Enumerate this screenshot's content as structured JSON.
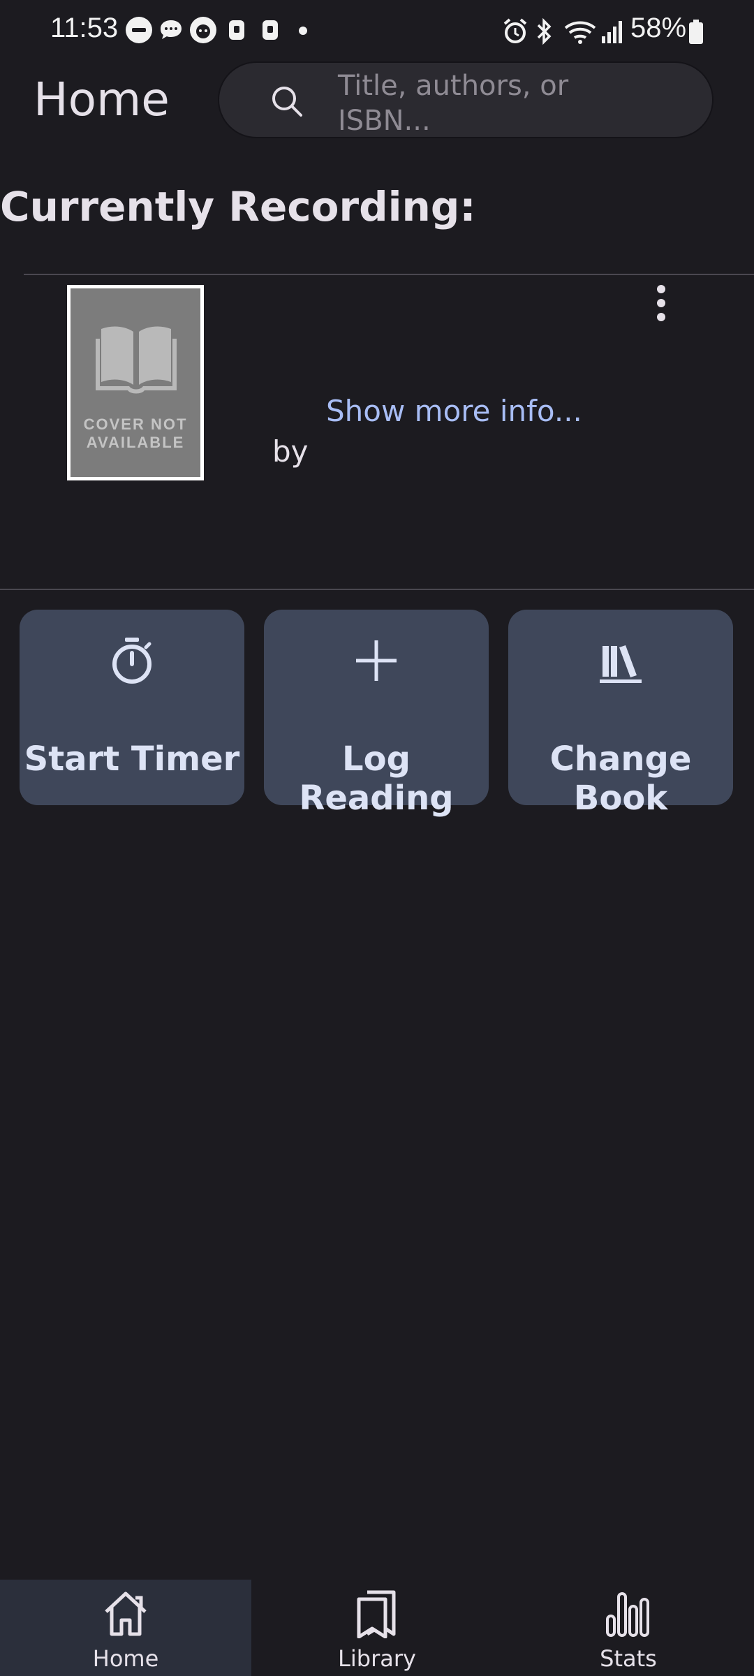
{
  "status_bar": {
    "time": "11:53",
    "battery": "58%"
  },
  "header": {
    "title": "Home",
    "search": {
      "placeholder": "Title, authors, or ISBN..."
    }
  },
  "section": {
    "title": "Currently Recording:"
  },
  "book": {
    "cover_label_line1": "COVER NOT",
    "cover_label_line2": "AVAILABLE",
    "show_more": "Show more info...",
    "by": "by"
  },
  "actions": [
    {
      "label": "Start Timer",
      "icon": "timer-icon"
    },
    {
      "label": "Log Reading",
      "icon": "plus-icon"
    },
    {
      "label": "Change Book",
      "icon": "books-icon"
    }
  ],
  "nav": {
    "items": [
      {
        "label": "Home",
        "icon": "home-icon",
        "active": true
      },
      {
        "label": "Library",
        "icon": "bookmarks-icon",
        "active": false
      },
      {
        "label": "Stats",
        "icon": "bar-chart-icon",
        "active": false
      }
    ]
  },
  "colors": {
    "background": "#1c1b20",
    "button": "#3f475a",
    "accent_link": "#a8bdf5",
    "nav_active": "#2b2f3b"
  }
}
